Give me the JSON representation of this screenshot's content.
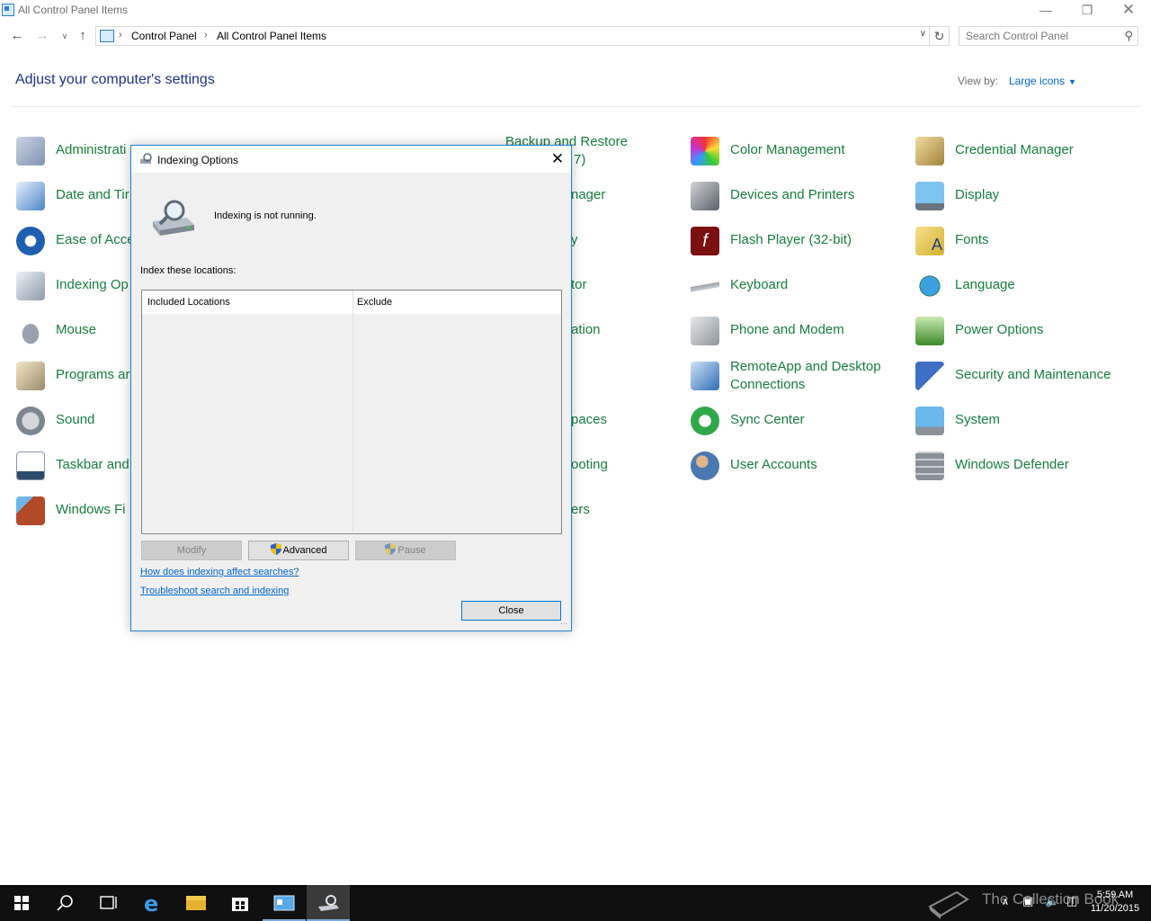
{
  "window": {
    "title": "All Control Panel Items"
  },
  "navigation": {
    "breadcrumbs": [
      "Control Panel",
      "All Control Panel Items"
    ],
    "search_placeholder": "Search Control Panel"
  },
  "header": {
    "heading": "Adjust your computer's settings",
    "view_by_label": "View by:",
    "view_by_value": "Large icons"
  },
  "items": {
    "col1": [
      "Administrati",
      "Date and Tir",
      "Ease of Acce",
      "Indexing Op",
      "Mouse",
      "Programs ar",
      "Sound",
      "Taskbar and",
      "Windows Fi"
    ],
    "col3": {
      "backup_line1": "Backup and Restore",
      "backup_line2": "7)",
      "r2": "nager",
      "r3": "y",
      "r4": "tor",
      "r5": "ation",
      "r7": "paces",
      "r8": "ooting",
      "r9": "ers"
    },
    "col4": [
      "Color Management",
      "Devices and Printers",
      "Flash Player (32-bit)",
      "Keyboard",
      "Phone and Modem",
      "RemoteApp and Desktop Connections",
      "Sync Center",
      "User Accounts"
    ],
    "col5": [
      "Credential Manager",
      "Display",
      "Fonts",
      "Language",
      "Power Options",
      "Security and Maintenance",
      "System",
      "Windows Defender"
    ]
  },
  "dialog": {
    "title": "Indexing Options",
    "status": "Indexing is not running.",
    "index_label": "Index these locations:",
    "col_included": "Included Locations",
    "col_exclude": "Exclude",
    "btn_modify": "Modify",
    "btn_advanced": "Advanced",
    "btn_pause": "Pause",
    "link_affect": "How does indexing affect searches?",
    "link_troubleshoot": "Troubleshoot search and indexing",
    "btn_close": "Close"
  },
  "taskbar": {
    "time": "5:59 AM",
    "date": "11/20/2015",
    "watermark": "The Collection Book"
  },
  "colors": {
    "link_green": "#167e3e",
    "heading_blue": "#1e3287",
    "accent": "#1883d7"
  }
}
